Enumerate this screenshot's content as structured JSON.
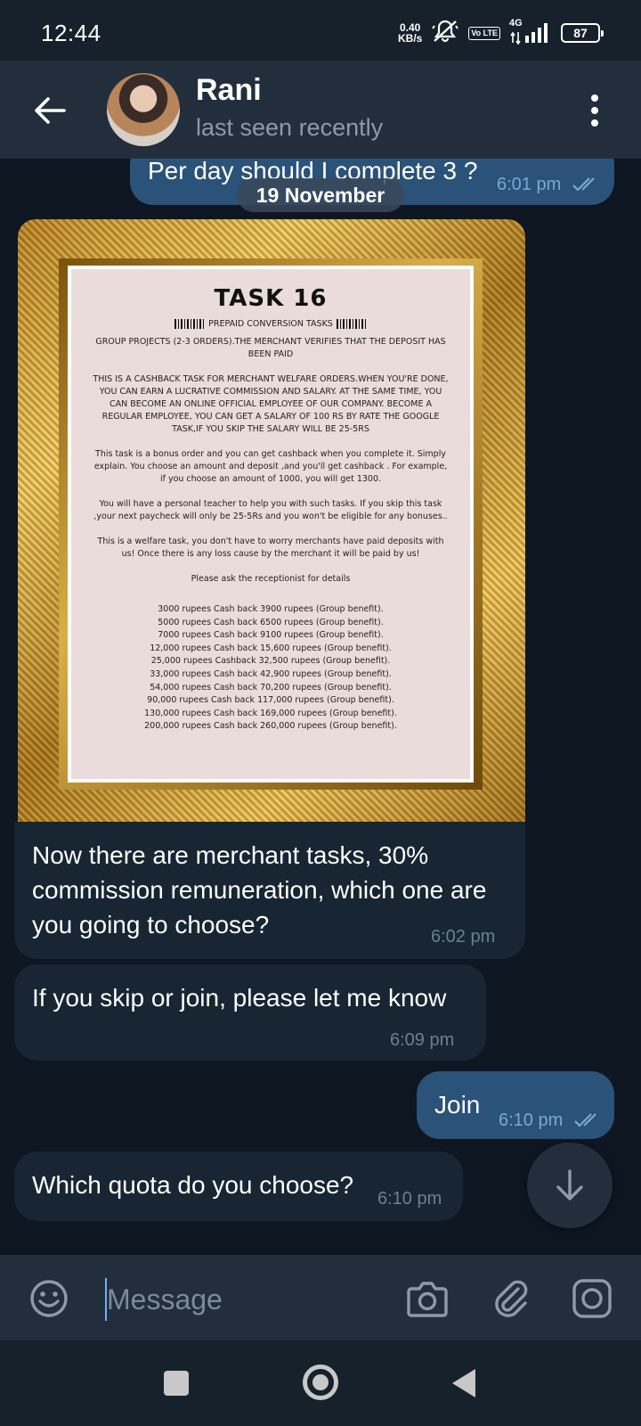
{
  "status_bar": {
    "time": "12:44",
    "net_speed_value": "0.40",
    "net_speed_unit": "KB/s",
    "volte": "Vo LTE",
    "network": "4G",
    "battery": "87"
  },
  "header": {
    "contact_name": "Rani",
    "contact_status": "last seen recently"
  },
  "chat": {
    "date_separator": "19 November",
    "messages": [
      {
        "direction": "outgoing",
        "text": "Per day should I complete 3 ?",
        "time": "6:01 pm",
        "read": true
      },
      {
        "direction": "incoming",
        "type": "photo"
      },
      {
        "direction": "incoming",
        "text": "Now there are merchant tasks, 30% commission remuneration, which one are you going to choose?",
        "time": "6:02 pm"
      },
      {
        "direction": "incoming",
        "text": "If you skip or join, please let me know",
        "time": "6:09 pm"
      },
      {
        "direction": "outgoing",
        "text": "Join",
        "time": "6:10 pm",
        "read": true
      },
      {
        "direction": "incoming",
        "text": "Which quota do you choose?",
        "time": "6:10 pm"
      }
    ]
  },
  "photo": {
    "title": "TASK 16",
    "subtitle": "PREPAID CONVERSION TASKS",
    "paragraphs": [
      "GROUP PROJECTS (2-3 ORDERS).THE MERCHANT VERIFIES THAT THE DEPOSIT HAS BEEN PAID",
      "THIS IS A CASHBACK TASK FOR MERCHANT WELFARE ORDERS.WHEN YOU'RE DONE, YOU CAN EARN A LUCRATIVE COMMISSION AND SALARY. AT THE SAME TIME, YOU CAN BECOME AN ONLINE OFFICIAL EMPLOYEE OF OUR COMPANY. BECOME A REGULAR EMPLOYEE, YOU CAN GET A SALARY OF 100 RS BY RATE THE GOOGLE TASK,IF YOU SKIP THE SALARY WILL BE 25-5RS",
      "This task is a bonus order and you can get cashback when you complete it. Simply explain. You choose an amount and deposit ,and you'll get cashback . For example, if you choose an amount of 1000, you will get 1300.",
      "You will have a personal teacher to help you with such tasks. If you skip this task ,your next paycheck will only be 25-5Rs and you won't be eligible for any bonuses..",
      "This is a welfare task, you don't have to worry merchants have paid deposits with us! Once there is any loss cause by the merchant it will be paid by us!",
      "Please ask the receptionist for details"
    ],
    "cashback_list": [
      "3000 rupees Cash back 3900 rupees (Group benefit).",
      "5000 rupees Cash back 6500 rupees (Group benefit).",
      "7000 rupees Cash back 9100 rupees (Group benefit).",
      "12,000 rupees Cash back 15,600 rupees (Group benefit).",
      "25,000 rupees Cashback 32,500 rupees (Group benefit).",
      "33,000 rupees Cash back 42,900 rupees (Group benefit).",
      "54,000 rupees Cash back 70,200 rupees (Group benefit).",
      "90,000 rupees Cash back 117,000 rupees (Group benefit).",
      "130,000 rupees Cash back 169,000 rupees (Group benefit).",
      "200,000 rupees Cash back 260,000 rupees (Group benefit)."
    ]
  },
  "input_bar": {
    "placeholder": "Message"
  },
  "colors": {
    "header_bg": "#232e3c",
    "chat_bg": "#0e1621",
    "bubble_out": "#2b5278",
    "bubble_in": "#182533",
    "accent": "#6ab2f2"
  },
  "icons": {
    "back": "arrow-left-icon",
    "menu": "more-vertical-icon",
    "emoji": "emoji-icon",
    "camera": "camera-icon",
    "attach": "paperclip-icon",
    "round_video": "round-video-icon",
    "scroll_down": "arrow-down-icon",
    "read_ticks": "double-check-icon"
  }
}
